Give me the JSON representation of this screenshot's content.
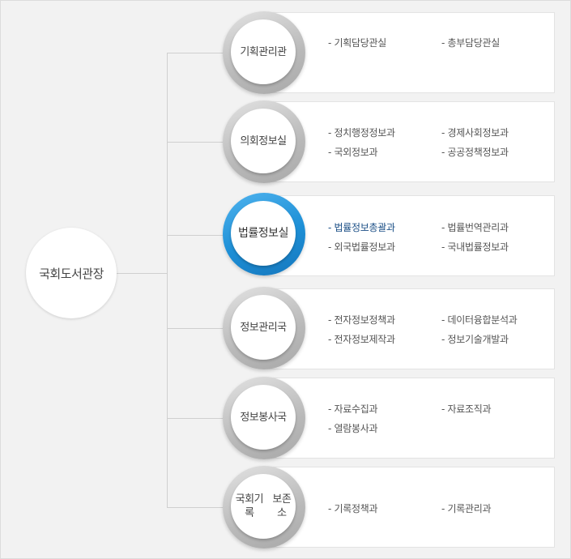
{
  "root": {
    "label": "국회도서관장"
  },
  "departments": [
    {
      "name_lines": [
        "기획관리관"
      ],
      "active": false,
      "subs": [
        "기획담당관실",
        "총부담당관실"
      ]
    },
    {
      "name_lines": [
        "의회정보실"
      ],
      "active": false,
      "subs": [
        "정치행정정보과",
        "경제사회정보과",
        "국외정보과",
        "공공정책정보과"
      ]
    },
    {
      "name_lines": [
        "법률정보실"
      ],
      "active": true,
      "active_sub": 0,
      "subs": [
        "법률정보총괄과",
        "법률번역관리과",
        "외국법률정보과",
        "국내법률정보과"
      ]
    },
    {
      "name_lines": [
        "정보관리국"
      ],
      "active": false,
      "subs": [
        "전자정보정책과",
        "데이터융합분석과",
        "전자정보제작과",
        "정보기술개발과"
      ]
    },
    {
      "name_lines": [
        "정보봉사국"
      ],
      "active": false,
      "subs": [
        "자료수집과",
        "자료조직과",
        "열람봉사과"
      ]
    },
    {
      "name_lines": [
        "국회기록",
        "보존소"
      ],
      "active": false,
      "subs": [
        "기록정책과",
        "기록관리과"
      ]
    }
  ],
  "colors": {
    "active_ring": "#1d8fd6",
    "active_text": "#1b4f86"
  }
}
